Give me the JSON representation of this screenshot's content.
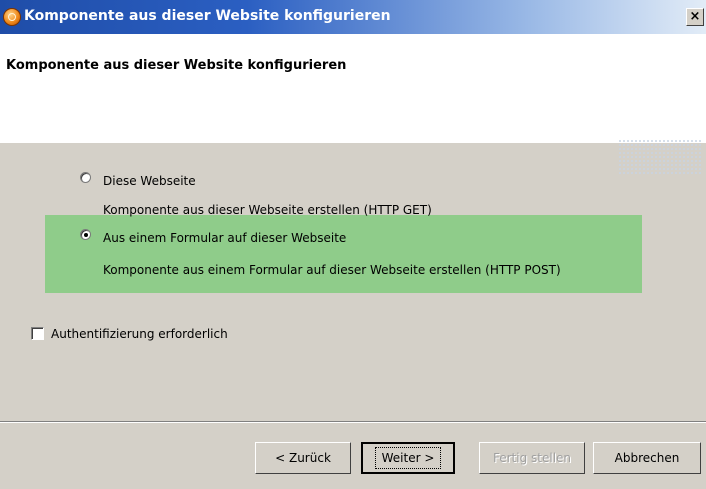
{
  "window": {
    "title": "Komponente aus dieser Website konfigurieren",
    "close_symbol": "×",
    "icon": "app-orange-globe-icon"
  },
  "banner": {
    "title": "Komponente aus dieser Website konfigurieren"
  },
  "options": [
    {
      "label": "Diese Webseite",
      "description": "Komponente aus dieser Webseite erstellen (HTTP GET)",
      "selected": false
    },
    {
      "label": "Aus einem Formular auf dieser Webseite",
      "description": "Komponente aus einem Formular auf dieser Webseite erstellen (HTTP POST)",
      "selected": true
    }
  ],
  "auth": {
    "label": "Authentifizierung erforderlich",
    "checked": false
  },
  "highlight_color": "#8fcc8a",
  "buttons": {
    "back": "< Zurück",
    "next": "Weiter >",
    "finish": "Fertig stellen",
    "cancel": "Abbrechen"
  }
}
